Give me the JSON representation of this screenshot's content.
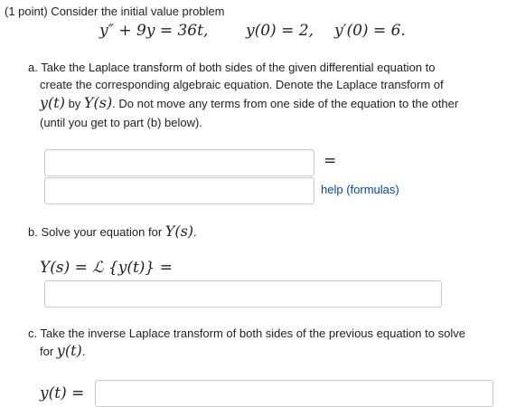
{
  "problem": {
    "intro": "(1 point) Consider the initial value problem",
    "equation": "y″ + 9y = 36t,",
    "ic1": "y(0) = 2,",
    "ic2": "y′(0) = 6."
  },
  "part_a": {
    "line1": "a. Take the Laplace transform of both sides of the given differential equation to",
    "line2": "create the corresponding algebraic equation. Denote the Laplace transform of",
    "line3_math1": "y(t)",
    "line3_by": " by ",
    "line3_math2": "Y(s)",
    "line3_rest": ". Do not move any terms from one side of the equation to the other",
    "line4": "(until you get to part (b) below).",
    "equals": "=",
    "lhs_value": "",
    "rhs_value": "",
    "help_link": "help (formulas)"
  },
  "part_b": {
    "prompt": "b. Solve your equation for ",
    "prompt_math": "Y(s)",
    "prompt_end": ".",
    "label": "Y(s) = ℒ {y(t)} =",
    "value": ""
  },
  "part_c": {
    "line1": "c. Take the inverse Laplace transform of both sides of the previous equation to solve",
    "line2_for": "for ",
    "line2_math": "y(t)",
    "line2_end": ".",
    "label": "y(t) =",
    "value": ""
  }
}
